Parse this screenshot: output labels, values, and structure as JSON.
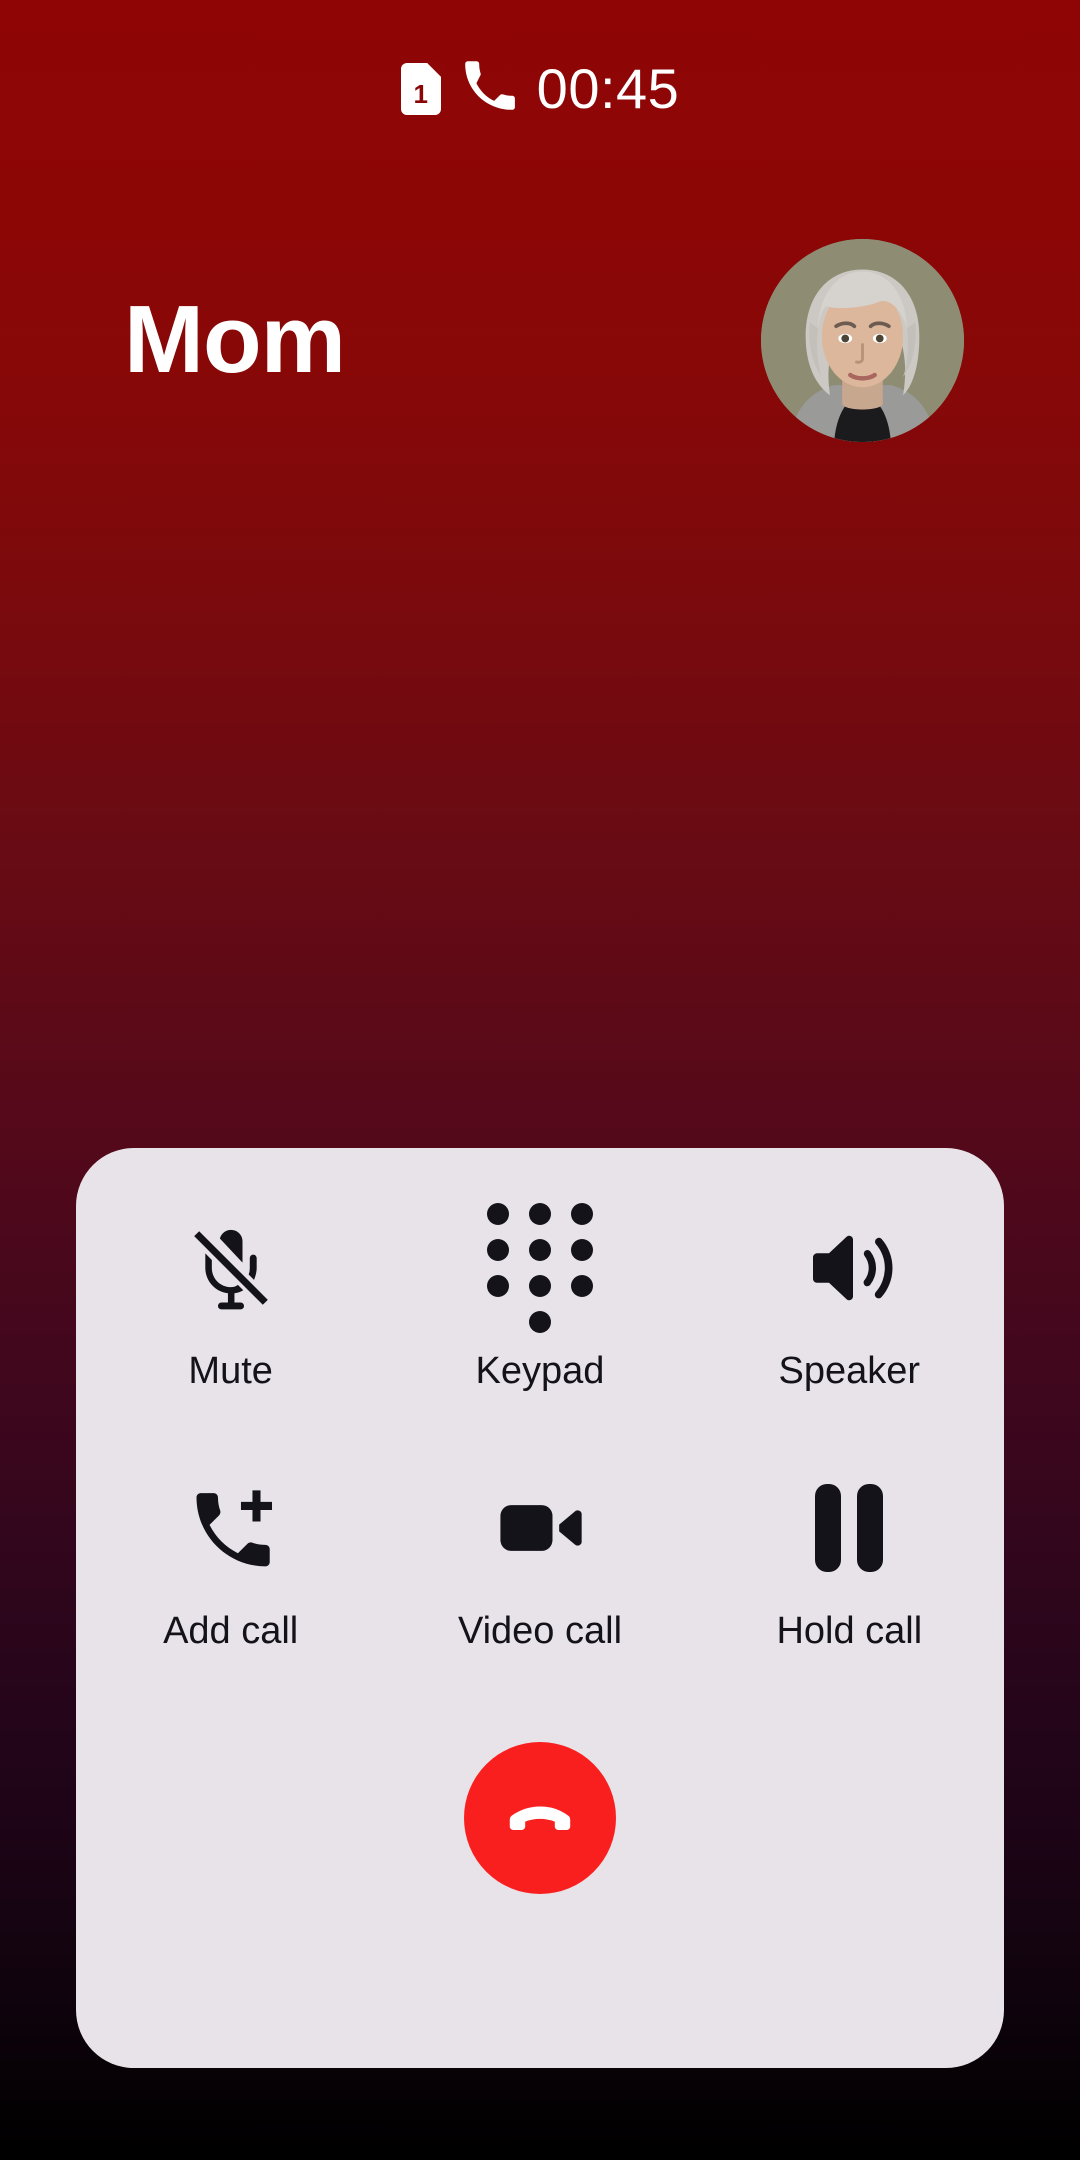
{
  "status_bar": {
    "sim_icon": "sim-card-icon",
    "sim_slot": "1",
    "call_icon": "phone-handset-icon",
    "timer": "00:45"
  },
  "caller": {
    "name": "Mom",
    "avatar_icon": "contact-avatar",
    "avatar_bg": "#8e8d74"
  },
  "controls": {
    "row1": [
      {
        "label": "Mute",
        "icon": "mic-off-icon"
      },
      {
        "label": "Keypad",
        "icon": "keypad-icon"
      },
      {
        "label": "Speaker",
        "icon": "speaker-icon"
      }
    ],
    "row2": [
      {
        "label": "Add call",
        "icon": "add-call-icon"
      },
      {
        "label": "Video call",
        "icon": "video-camera-icon"
      },
      {
        "label": "Hold call",
        "icon": "pause-icon"
      }
    ]
  },
  "end_call": {
    "icon": "end-call-handset-icon",
    "color": "#fa1f1f"
  },
  "theme": {
    "background_top": "#8f0505",
    "background_bottom": "#000000",
    "panel": "#e8e3e8",
    "text_on_panel": "#14131a",
    "text_on_background": "#ffffff"
  }
}
